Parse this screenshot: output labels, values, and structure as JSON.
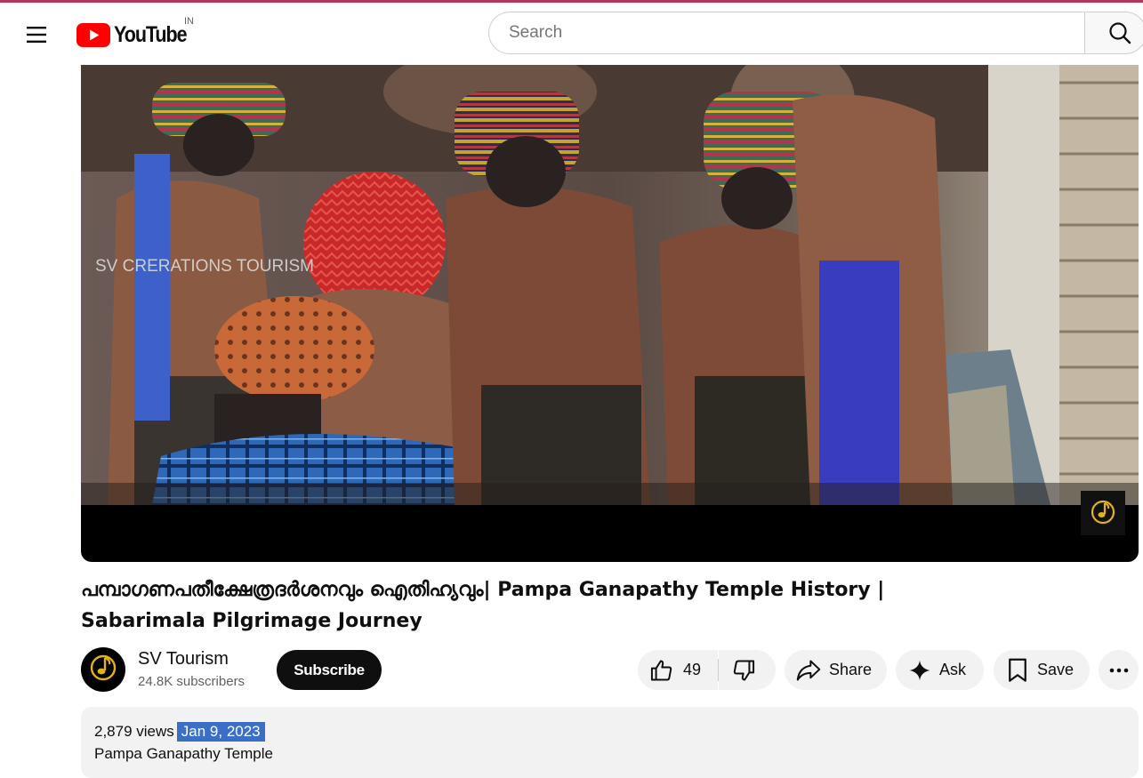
{
  "masthead": {
    "logo_text": "YouTube",
    "country_code": "IN",
    "search_placeholder": "Search"
  },
  "player": {
    "watermark_text": "SV CRERATIONS TOURISM"
  },
  "video": {
    "title_line1": "പമ്പാഗണപതീക്ഷേത്രദർശനവും ഐതിഹ്യവും| Pampa Ganapathy Temple History |",
    "title_line2": "Sabarimala Pilgrimage Journey"
  },
  "owner": {
    "channel_name": "SV Tourism",
    "subscribers": "24.8K subscribers",
    "subscribe_label": "Subscribe"
  },
  "actions": {
    "like_count": "49",
    "share_label": "Share",
    "ask_label": "Ask",
    "save_label": "Save"
  },
  "description": {
    "views": "2,879 views",
    "date": "Jan 9, 2023",
    "text": "Pampa Ganapathy Temple"
  },
  "colors": {
    "brand_red": "#ff0000",
    "selection_highlight": "#3b6fc6",
    "top_accent": "#b3365b"
  },
  "icons": [
    "menu-icon",
    "youtube-logo-icon",
    "search-icon",
    "like-icon",
    "dislike-icon",
    "share-icon",
    "ask-sparkle-icon",
    "save-icon",
    "more-icon"
  ]
}
